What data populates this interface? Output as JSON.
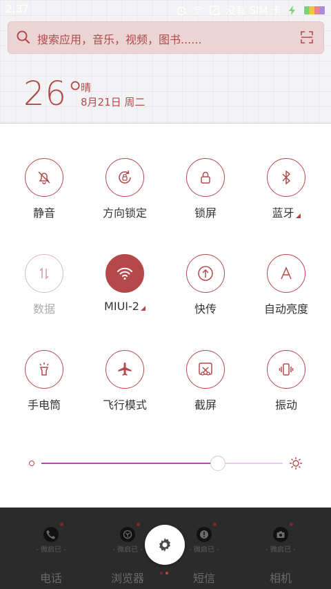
{
  "status_bar": {
    "time": "2:37",
    "carrier": "没有 SIM 卡"
  },
  "search": {
    "placeholder": "搜索应用，音乐，视频，图书......"
  },
  "weather": {
    "temperature": "26°",
    "condition": "晴",
    "date": "8月21日 周二"
  },
  "toggles": [
    {
      "label": "静音",
      "icon": "bell-off-icon",
      "state": "off"
    },
    {
      "label": "方向锁定",
      "icon": "rotation-lock-icon",
      "state": "off"
    },
    {
      "label": "锁屏",
      "icon": "lock-icon",
      "state": "off"
    },
    {
      "label": "蓝牙",
      "icon": "bluetooth-icon",
      "state": "off",
      "has_more": true
    },
    {
      "label": "数据",
      "icon": "mobile-data-icon",
      "state": "disabled"
    },
    {
      "label": "MIUI-2",
      "icon": "wifi-icon",
      "state": "on",
      "has_more": true
    },
    {
      "label": "快传",
      "icon": "share-transfer-icon",
      "state": "off"
    },
    {
      "label": "自动亮度",
      "icon": "auto-brightness-icon",
      "state": "off"
    },
    {
      "label": "手电筒",
      "icon": "flashlight-icon",
      "state": "off"
    },
    {
      "label": "飞行模式",
      "icon": "airplane-icon",
      "state": "off"
    },
    {
      "label": "截屏",
      "icon": "screenshot-icon",
      "state": "off"
    },
    {
      "label": "振动",
      "icon": "vibrate-icon",
      "state": "off"
    }
  ],
  "brightness": {
    "level_fraction": 0.73
  },
  "dock": {
    "apps": [
      {
        "label": "电话",
        "sub": "- 微启已 -",
        "icon": "phone-icon"
      },
      {
        "label": "浏览器",
        "sub": "- 微启已 -",
        "icon": "browser-icon"
      },
      {
        "label": "短信",
        "sub": "- 微启已 -",
        "icon": "message-icon"
      },
      {
        "label": "相机",
        "sub": "- 微启已 -",
        "icon": "camera-icon"
      }
    ]
  },
  "colors": {
    "accent": "#b5484a",
    "slider": "#c23cc4",
    "dock_bg": "#2b2b2b"
  }
}
